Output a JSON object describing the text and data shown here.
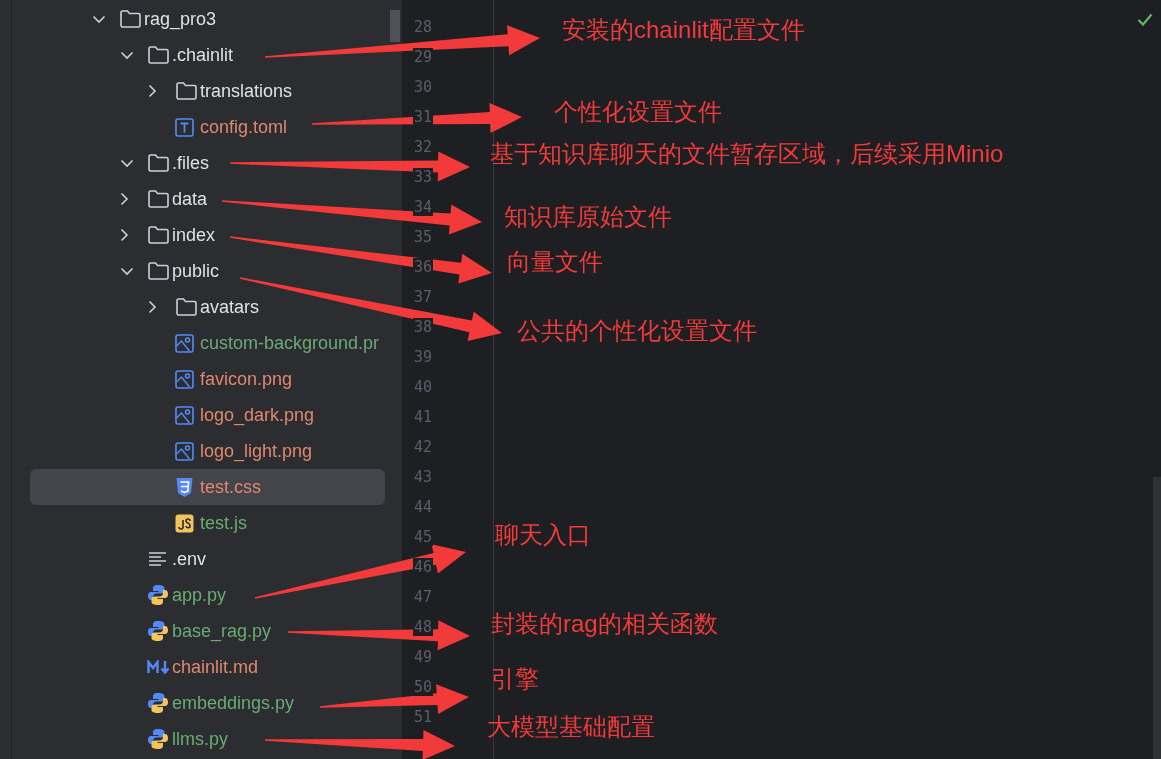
{
  "tree": [
    {
      "name": "rag_pro3",
      "kind": "folder",
      "expanded": true,
      "selected": false,
      "color": "#dfe1e5",
      "children": [
        {
          "name": ".chainlit",
          "kind": "folder",
          "expanded": true,
          "selected": false,
          "color": "#dfe1e5",
          "note": "安装的chainlit配置文件",
          "children": [
            {
              "name": "translations",
              "kind": "folder",
              "expanded": false,
              "selected": false,
              "color": "#dfe1e5"
            },
            {
              "name": "config.toml",
              "kind": "toml",
              "selected": false,
              "color": "#e0876f",
              "note": "个性化设置文件"
            }
          ]
        },
        {
          "name": ".files",
          "kind": "folder",
          "expanded": true,
          "selected": false,
          "color": "#dfe1e5",
          "note": "基于知识库聊天的文件暂存区域，后续采用Minio"
        },
        {
          "name": "data",
          "kind": "folder",
          "expanded": false,
          "selected": false,
          "color": "#dfe1e5",
          "note": "知识库原始文件"
        },
        {
          "name": "index",
          "kind": "folder",
          "expanded": false,
          "selected": false,
          "color": "#dfe1e5",
          "note": "向量文件"
        },
        {
          "name": "public",
          "kind": "folder",
          "expanded": true,
          "selected": false,
          "color": "#dfe1e5",
          "note": "公共的个性化设置文件",
          "children": [
            {
              "name": "avatars",
              "kind": "folder",
              "expanded": false,
              "selected": false,
              "color": "#dfe1e5"
            },
            {
              "name": "custom-background.pr",
              "kind": "image",
              "selected": false,
              "color": "#6aab73"
            },
            {
              "name": "favicon.png",
              "kind": "image",
              "selected": false,
              "color": "#e0876f"
            },
            {
              "name": "logo_dark.png",
              "kind": "image",
              "selected": false,
              "color": "#e0876f"
            },
            {
              "name": "logo_light.png",
              "kind": "image",
              "selected": false,
              "color": "#e0876f"
            },
            {
              "name": "test.css",
              "kind": "css",
              "selected": true,
              "color": "#e0876f"
            },
            {
              "name": "test.js",
              "kind": "js",
              "selected": false,
              "color": "#6aab73"
            }
          ]
        },
        {
          "name": ".env",
          "kind": "text",
          "selected": false,
          "color": "#dfe1e5"
        },
        {
          "name": "app.py",
          "kind": "python",
          "selected": false,
          "color": "#6aab73",
          "note": "聊天入口"
        },
        {
          "name": "base_rag.py",
          "kind": "python",
          "selected": false,
          "color": "#6aab73",
          "note": "封装的rag的相关函数"
        },
        {
          "name": "chainlit.md",
          "kind": "markdown",
          "selected": false,
          "color": "#e0876f"
        },
        {
          "name": "embeddings.py",
          "kind": "python",
          "selected": false,
          "color": "#6aab73",
          "note": "引擎"
        },
        {
          "name": "llms.py",
          "kind": "python",
          "selected": false,
          "color": "#6aab73",
          "note": "大模型基础配置"
        }
      ]
    }
  ],
  "gutter": {
    "line_numbers": [
      "28",
      "29",
      "30",
      "31",
      "32",
      "33",
      "34",
      "35",
      "36",
      "37",
      "38",
      "39",
      "40",
      "41",
      "42",
      "43",
      "44",
      "45",
      "46",
      "47",
      "48",
      "49",
      "50",
      "51"
    ]
  },
  "editor": {
    "inspection_ok": true
  }
}
